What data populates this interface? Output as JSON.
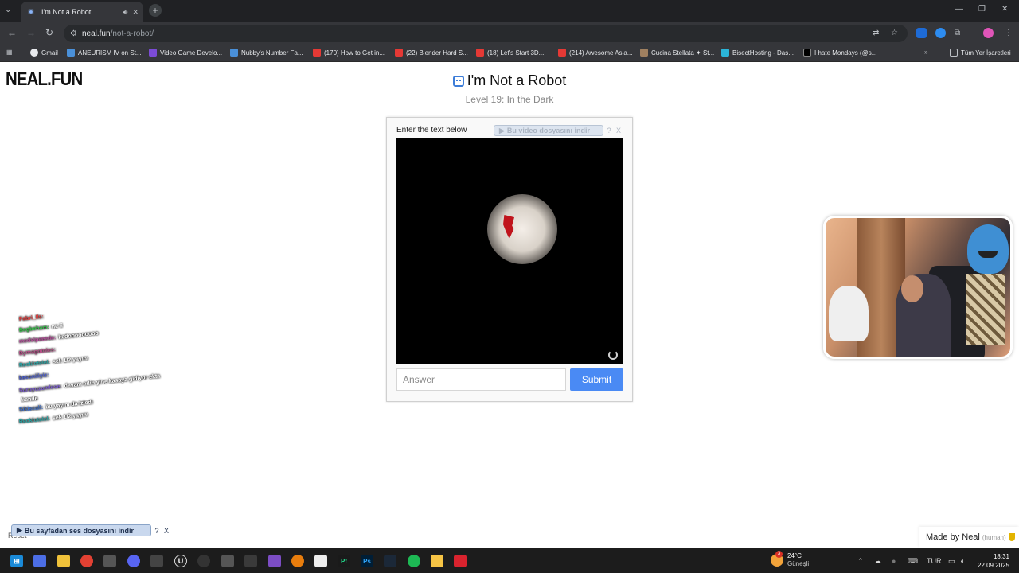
{
  "browser": {
    "tab_title": "I'm Not a Robot",
    "url_host": "neal.fun",
    "url_path": "/not-a-robot/",
    "bookmarks": [
      "Gmail",
      "ANEURISM IV on St...",
      "Video Game Develo...",
      "Nubby's Number Fa...",
      "(170) How to Get in...",
      "(22) Blender Hard S...",
      "(18) Let's Start 3D...",
      "(214) Awesome Asia...",
      "Cucina Stellata ✦ St...",
      "BisectHosting - Das...",
      "I hate Mondays (@s..."
    ],
    "bookmarks_folder": "Tüm Yer İşaretleri",
    "colors": {
      "chrome_dark": "#202124",
      "toolbar": "#35363a",
      "accent": "#4a8af4"
    }
  },
  "page": {
    "logo": "NEAL.FUN",
    "title": "I'm Not a Robot",
    "level": "Level 19: In the Dark",
    "captcha": {
      "instruction": "Enter the text below",
      "video_download": "Bu video dosyasını indir",
      "help": "?",
      "close": "X",
      "answer_placeholder": "Answer",
      "submit": "Submit"
    },
    "sound_download": "Bu sayfadan ses dosyasını indir",
    "reset": "Reset",
    "made_by": "Made by Neal",
    "made_by_note": "(human)"
  },
  "chat": [
    {
      "name": "Fabri_Ils:",
      "msg": "",
      "color": "#e23b3b"
    },
    {
      "name": "Begbeham:",
      "msg": "ne ii",
      "color": "#35c94a"
    },
    {
      "name": "medsipaeede:",
      "msg": "kedooooooooo",
      "color": "#c04fa2"
    },
    {
      "name": "Bymagotnies:",
      "msg": "",
      "color": "#c14e8c"
    },
    {
      "name": "Recklotelel:",
      "msg": "sek 1/2 yayını",
      "color": "#26a6a6"
    },
    {
      "name": "kesoniliyiz:",
      "msg": "",
      "color": "#4a5ed8"
    },
    {
      "name": "Suruyuzumlese:",
      "msg": "devam edin yine kasaya gidiyor ekta",
      "color": "#7b5ad0"
    },
    {
      "name": "",
      "msg": "bende",
      "color": "#888888"
    },
    {
      "name": "Sikiscali:",
      "msg": "bu yayını da izledi",
      "color": "#3a6fd0"
    },
    {
      "name": "Recklotelel:",
      "msg": "sek 1/2 yayını",
      "color": "#26a6a6"
    }
  ],
  "taskbar": {
    "weather_temp": "24°C",
    "weather_desc": "Güneşli",
    "weather_badge": "3",
    "lang": "TUR",
    "time": "18:31",
    "date": "22.09.2025"
  }
}
